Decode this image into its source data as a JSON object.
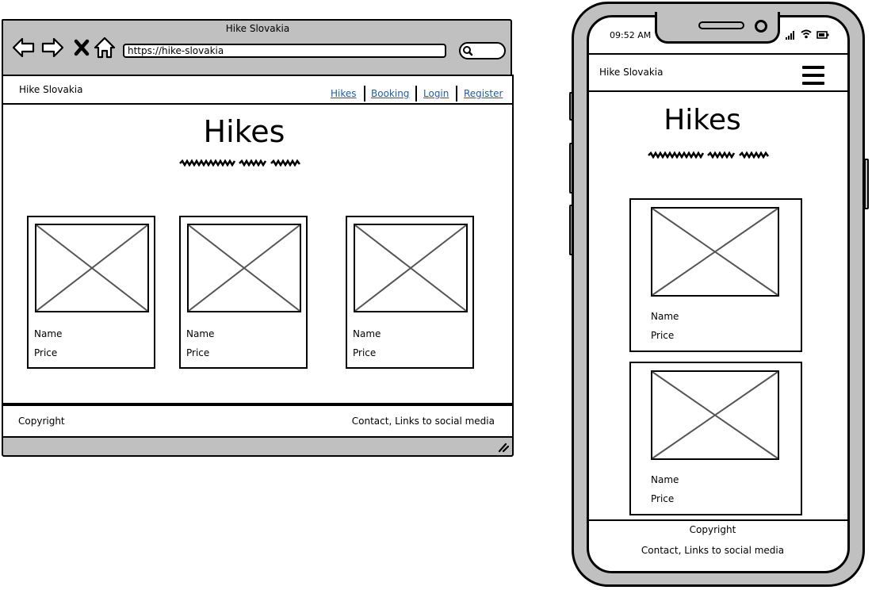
{
  "browser": {
    "window_title": "Hike Slovakia",
    "url": "https://hike-slovakia",
    "chrome_color": "#c0c0c0"
  },
  "site": {
    "brand": "Hike Slovakia",
    "nav_links": [
      "Hikes",
      "Booking",
      "Login",
      "Register"
    ],
    "link_color": "#1f5ea8",
    "heading": "Hikes",
    "cards": [
      {
        "name": "Name",
        "price": "Price"
      },
      {
        "name": "Name",
        "price": "Price"
      },
      {
        "name": "Name",
        "price": "Price"
      }
    ],
    "footer": {
      "left": "Copyright",
      "right": "Contact, Links to social media"
    }
  },
  "mobile": {
    "status_time": "09:52 AM",
    "brand": "Hike Slovakia",
    "heading": "Hikes",
    "cards": [
      {
        "name": "Name",
        "price": "Price"
      },
      {
        "name": "Name",
        "price": "Price"
      }
    ],
    "footer": {
      "copyright": "Copyright",
      "contact": "Contact, Links to social media"
    }
  },
  "icons": [
    "back-arrow-icon",
    "forward-arrow-icon",
    "stop-icon",
    "home-icon",
    "search-icon",
    "resize-grip-icon",
    "signal-icon",
    "wifi-icon",
    "battery-icon",
    "hamburger-menu-icon",
    "image-placeholder-icon"
  ]
}
